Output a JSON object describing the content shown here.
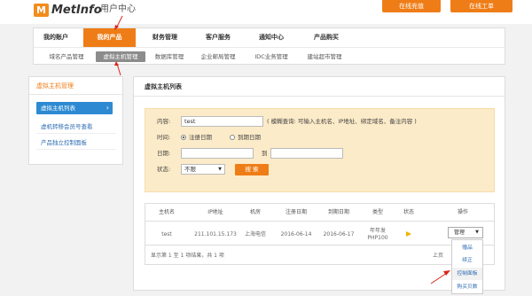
{
  "header": {
    "logo_letter": "M",
    "logo_text": "MetInfo",
    "site_title": "用户中心",
    "recharge_label": "在线充值",
    "ticket_label": "在线工单"
  },
  "nav": {
    "items": [
      {
        "label": "我的账户"
      },
      {
        "label": "我的产品"
      },
      {
        "label": "财务管理"
      },
      {
        "label": "客户服务"
      },
      {
        "label": "通知中心"
      },
      {
        "label": "产品购买"
      }
    ]
  },
  "subnav": {
    "items": [
      {
        "label": "域名产品管理"
      },
      {
        "label": "虚拟主机管理"
      },
      {
        "label": "数据库管理"
      },
      {
        "label": "企业邮局管理"
      },
      {
        "label": "IDC业务管理"
      },
      {
        "label": "建站超市管理"
      }
    ]
  },
  "sidebar": {
    "title": "虚拟主机管理",
    "items": [
      {
        "label": "虚拟主机列表"
      },
      {
        "label": "虚机转移会员号查看"
      },
      {
        "label": "产品独立控制面板"
      }
    ]
  },
  "main": {
    "title": "虚拟主机列表"
  },
  "filter": {
    "content_label": "内容:",
    "content_value": "test",
    "content_hint": "( 模糊查询: 可输入主机名、IP地址、绑定域名、备注内容 )",
    "time_label": "时间:",
    "radio_register": "注册日期",
    "radio_expire": "到期日期",
    "date_label": "日期:",
    "to_label": "到",
    "status_label": "状态:",
    "status_value": "不限",
    "search_label": "搜 索"
  },
  "table": {
    "headers": [
      "主机名",
      "IP地址",
      "机房",
      "注册日期",
      "到期日期",
      "类型",
      "状态",
      "操作"
    ],
    "rows": [
      {
        "hostname": "test",
        "ip": "211.101.15.173",
        "room": "上海电信",
        "reg_date": "2016-06-14",
        "exp_date": "2016-06-17",
        "type_line1": "年年发",
        "type_line2": "PHP100",
        "action": "管理"
      }
    ],
    "footer": "显示第 1 至 1 项结果，共 1 项",
    "pager_prev": "上页"
  },
  "dropdown": {
    "items": [
      {
        "label": "赠品"
      },
      {
        "label": "续正"
      },
      {
        "label": "控制面板"
      },
      {
        "label": "购买贝数"
      }
    ]
  },
  "colors": {
    "accent": "#ef7d17",
    "link": "#2d6bb3",
    "active_side": "#2d8ad2",
    "filter_bg": "#fcebc8",
    "annotation_arrow": "#d9261c"
  }
}
